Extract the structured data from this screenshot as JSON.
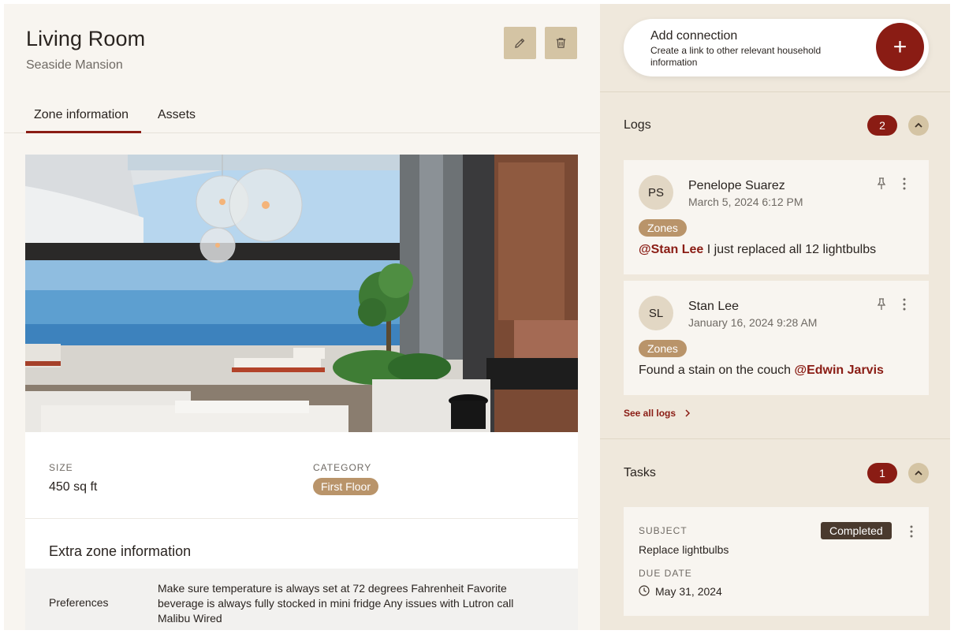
{
  "zone": {
    "title": "Living Room",
    "subtitle": "Seaside Mansion"
  },
  "tabs": [
    {
      "label": "Zone information",
      "active": true
    },
    {
      "label": "Assets",
      "active": false
    }
  ],
  "details": {
    "size_label": "SIZE",
    "size_value": "450 sq ft",
    "category_label": "CATEGORY",
    "category_value": "First Floor",
    "extra_title": "Extra zone information",
    "preferences_label": "Preferences",
    "preferences_text": "Make sure temperature is always set at 72 degrees Fahrenheit Favorite beverage is always fully stocked in mini fridge Any issues with Lutron call Malibu Wired"
  },
  "add_connection": {
    "title": "Add connection",
    "description": "Create a link to other relevant household information"
  },
  "logs": {
    "title": "Logs",
    "count": "2",
    "items": [
      {
        "initials": "PS",
        "name": "Penelope Suarez",
        "time": "March 5, 2024 6:12 PM",
        "tag": "Zones",
        "mention": "@Stan Lee",
        "text": "I just replaced all 12 lightbulbs"
      },
      {
        "initials": "SL",
        "name": "Stan Lee",
        "time": "January 16, 2024 9:28 AM",
        "tag": "Zones",
        "text": "Found a stain on the couch",
        "mention": "@Edwin Jarvis"
      }
    ],
    "see_all": "See all logs"
  },
  "tasks": {
    "title": "Tasks",
    "count": "1",
    "items": [
      {
        "subject_label": "SUBJECT",
        "subject": "Replace lightbulbs",
        "status": "Completed",
        "due_label": "DUE DATE",
        "due_date": "May 31, 2024"
      }
    ]
  },
  "colors": {
    "accent": "#8a1c14",
    "badge_tan": "#b9946a",
    "button_tan": "#d4c4a4",
    "sidebar_bg": "#efe8dc",
    "main_bg": "#f8f5f0",
    "status_dark": "#4a3a2e"
  }
}
